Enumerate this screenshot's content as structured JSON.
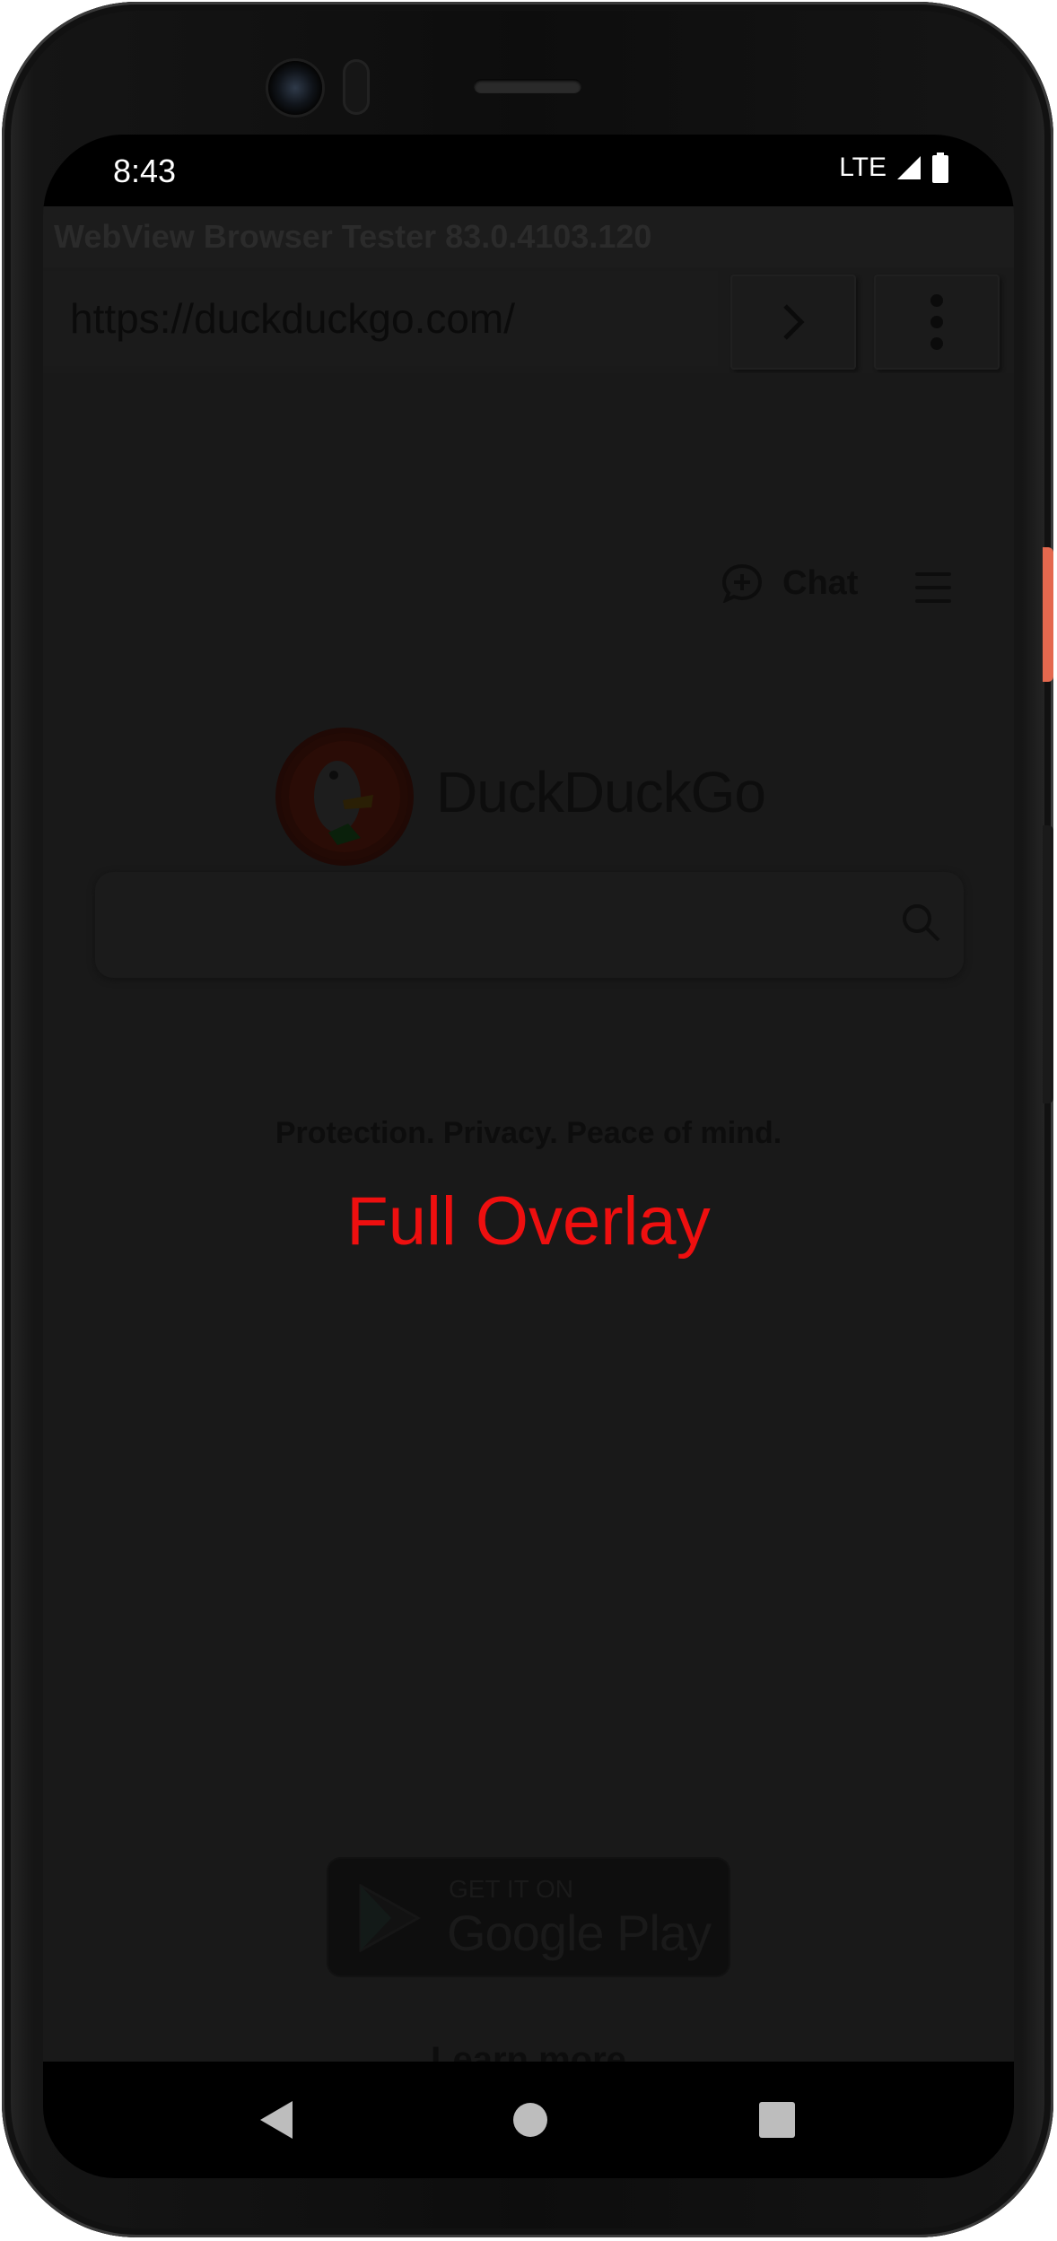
{
  "status_bar": {
    "time": "8:43",
    "network": "LTE",
    "icons": [
      "signal-icon",
      "battery-icon"
    ]
  },
  "app": {
    "title": "WebView Browser Tester 83.0.4103.120",
    "url": "https://duckduckgo.com/",
    "go_icon": "chevron-right-icon",
    "menu_icon": "more-vert-icon"
  },
  "page": {
    "chat_label": "Chat",
    "brand": "DuckDuckGo",
    "search_placeholder": "",
    "tagline": "Protection. Privacy. Peace of mind.",
    "overlay_text": "Full Overlay",
    "play_badge": {
      "small": "GET IT ON",
      "big": "Google Play"
    },
    "learn_more": "Learn more"
  },
  "nav_bar": {
    "icons": [
      "back-icon",
      "home-icon",
      "recents-icon"
    ]
  },
  "colors": {
    "overlay_text": "#ee0f0f",
    "power_button": "#e4684e",
    "overlay_tint": "#171717"
  }
}
